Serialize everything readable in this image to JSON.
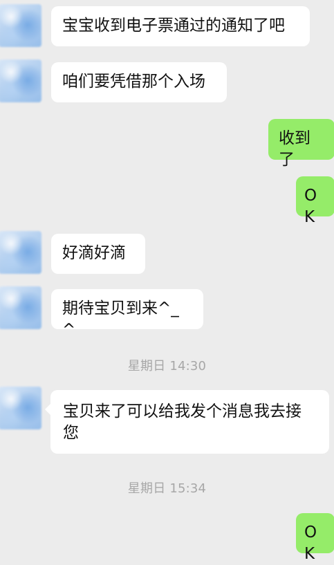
{
  "messages": [
    {
      "side": "left",
      "text": "宝宝收到电子票通过的通知了吧"
    },
    {
      "side": "left",
      "text": "咱们要凭借那个入场"
    },
    {
      "side": "right",
      "text": "收到了"
    },
    {
      "side": "right",
      "text": "OK"
    },
    {
      "side": "left",
      "text": "好滴好滴"
    },
    {
      "side": "left",
      "text": "期待宝贝到来^_^"
    },
    {
      "type": "timestamp",
      "text": "星期日 14:30"
    },
    {
      "side": "left",
      "text": "宝贝来了可以给我发个消息我去接您"
    },
    {
      "type": "timestamp",
      "text": "星期日 15:34"
    },
    {
      "side": "right",
      "text": "OK"
    }
  ],
  "colors": {
    "background": "#ececec",
    "incoming_bubble": "#ffffff",
    "outgoing_bubble": "#95ec69",
    "timestamp_text": "#a7a7a7"
  }
}
